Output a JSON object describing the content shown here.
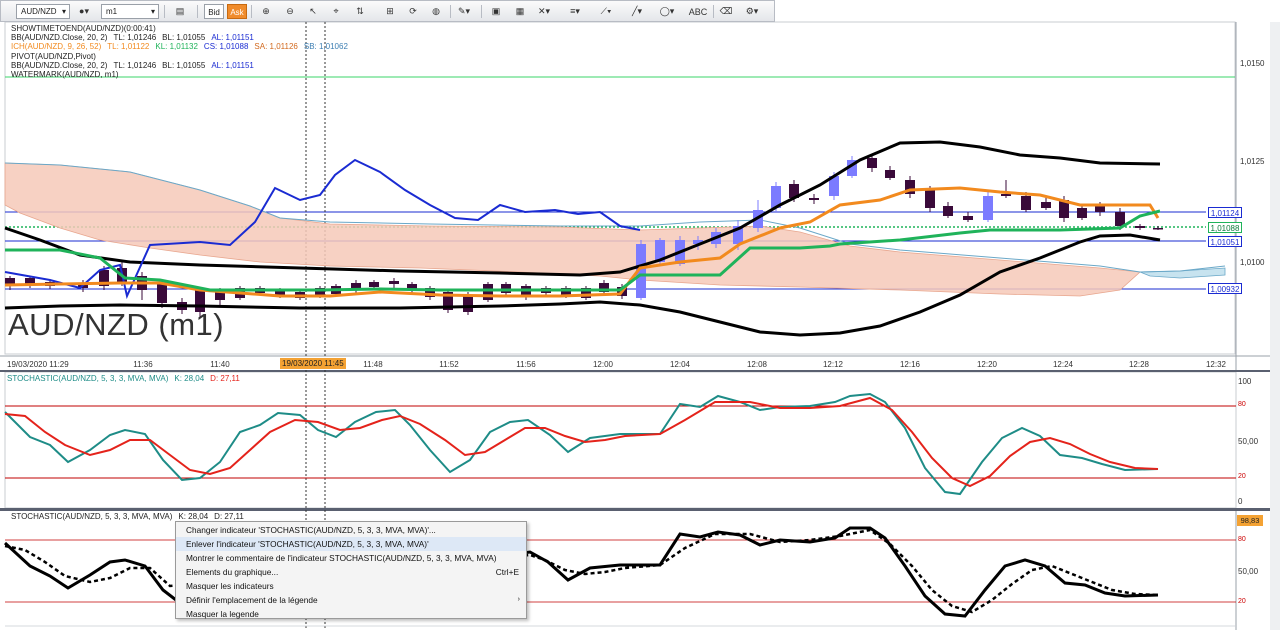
{
  "toolbar": {
    "symbol": "AUD/NZD",
    "timeframe": "m1",
    "bid_label": "Bid",
    "ask_label": "Ask"
  },
  "legend": {
    "line1": "SHOWTIMETOEND(AUD/NZD)(0:00:41)",
    "line2_a": "BB(AUD/NZD.Close, 20, 2)",
    "line2_b": "TL: 1,01246",
    "line2_c": "BL: 1,01055",
    "line2_d": "AL: 1,01151",
    "line3_a": "ICH(AUD/NZD, 9, 26, 52)",
    "line3_b": "TL: 1,01122",
    "line3_c": "KL: 1,01132",
    "line3_d": "CS: 1,01088",
    "line3_e": "SA: 1,01126",
    "line3_f": "SB: 1,01062",
    "line4": "PIVOT(AUD/NZD,Pivot)",
    "line5_a": "BB(AUD/NZD.Close, 20, 2)",
    "line5_b": "TL: 1,01246",
    "line5_c": "BL: 1,01055",
    "line5_d": "AL: 1,01151",
    "line6": "WATERMARK(AUD/NZD, m1)"
  },
  "watermark": "AUD/NZD (m1)",
  "price_axis": [
    "1,0150",
    "1,0125",
    "1,0100"
  ],
  "price_tags": {
    "upper": "1,01124",
    "mid": "1,01088",
    "lower": "1,01051",
    "pivot": "1,00932"
  },
  "time_axis": [
    "19/03/2020 11:29",
    "11:36",
    "11:40",
    "11:48",
    "11:52",
    "11:56",
    "12:00",
    "12:04",
    "12:08",
    "12:12",
    "12:16",
    "12:20",
    "12:24",
    "12:28",
    "12:32"
  ],
  "crosshair_time": "19/03/2020 11:45",
  "stoch1": {
    "name": "STOCHASTIC(AUD/NZD, 5, 3, 3, MVA, MVA)",
    "k": "K: 28,04",
    "d": "D: 27,11",
    "axis": [
      "100",
      "80",
      "50,00",
      "20",
      "0"
    ]
  },
  "stoch2": {
    "name": "STOCHASTIC(AUD/NZD, 5, 3, 3, MVA, MVA)",
    "k": "K: 28,04",
    "d": "D: 27,11",
    "value_tag": "98,83",
    "axis": [
      "80",
      "50,00",
      "20"
    ]
  },
  "menu": {
    "items": [
      "Changer indicateur 'STOCHASTIC(AUD/NZD, 5, 3, 3, MVA, MVA)'...",
      "Enlever l'indicateur 'STOCHASTIC(AUD/NZD, 5, 3, 3, MVA, MVA)'",
      "Montrer le commentaire de l'indicateur STOCHASTIC(AUD/NZD, 5, 3, 3, MVA, MVA)",
      "Elements du graphique...",
      "Masquer les indicateurs",
      "Définir l'emplacement de la légende",
      "Masquer la legende"
    ],
    "shortcut": "Ctrl+E",
    "submenu_arrow": "›"
  },
  "colors": {
    "bull": "#7b7bff",
    "bear": "#3a0a3a",
    "bb": "#000000",
    "tenkan": "#f28a1e",
    "kijun": "#1fb35a",
    "chikou": "#1a2bd2",
    "cloud_up": "#f6c9b8",
    "cloud_down": "#c7e3ef",
    "stoch_k": "#1e8c87",
    "stoch_d": "#e4231b",
    "level": "#c00000"
  }
}
